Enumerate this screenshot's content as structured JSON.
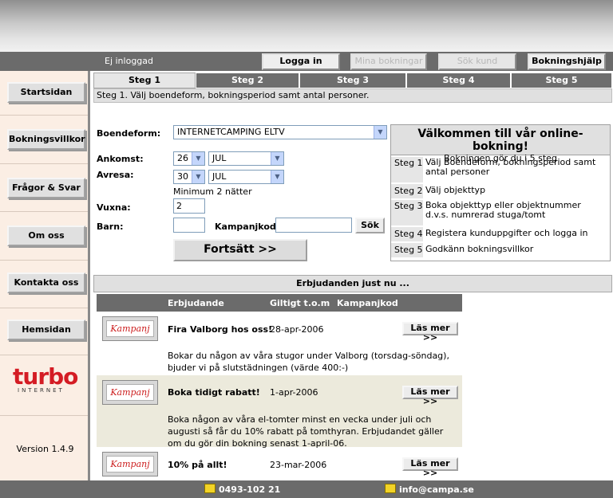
{
  "topbar": {
    "status": "Ej inloggad",
    "login": "Logga in",
    "my_bookings": "Mina bokningar",
    "search_customer": "Sök kund",
    "help": "Bokningshjälp"
  },
  "sidebar": {
    "items": [
      {
        "label": "Startsidan"
      },
      {
        "label": "Bokningsvillkor"
      },
      {
        "label": "Frågor & Svar"
      },
      {
        "label": "Om oss"
      },
      {
        "label": "Kontakta oss"
      },
      {
        "label": "Hemsidan"
      }
    ],
    "logo_main": "turbo",
    "logo_sub": "INTERNET",
    "version": "Version 1.4.9"
  },
  "steps": {
    "tabs": [
      "Steg 1",
      "Steg 2",
      "Steg 3",
      "Steg 4",
      "Steg 5"
    ],
    "active_index": 0,
    "info": "Steg 1. Välj boendeform, bokningsperiod samt antal personer."
  },
  "form": {
    "boendeform_label": "Boendeform:",
    "boendeform_value": "INTERNETCAMPING ELTV",
    "ankomst_label": "Ankomst:",
    "ankomst_day": "26",
    "ankomst_month": "JUL",
    "avresa_label": "Avresa:",
    "avresa_day": "30",
    "avresa_month": "JUL",
    "min_note": "Minimum 2 nätter",
    "vuxna_label": "Vuxna:",
    "vuxna_value": "2",
    "barn_label": "Barn:",
    "barn_value": "",
    "kampanjkod_label": "Kampanjkod:",
    "kampanjkod_value": "",
    "search_button": "Sök",
    "continue_button": "Fortsätt >>"
  },
  "welcome": {
    "title": "Välkommen till vår online-bokning!",
    "subtitle": "Bokningen gör du i 5 steg",
    "steps": [
      {
        "num": "Steg 1",
        "text": "Välj Boendeform, bokningsperiod samt antal personer"
      },
      {
        "num": "Steg 2",
        "text": "Välj objekttyp"
      },
      {
        "num": "Steg 3",
        "text": "Boka objekttyp eller objektnummer d.v.s. numrerad stuga/tomt"
      },
      {
        "num": "Steg 4",
        "text": "Registera kunduppgifter och logga in"
      },
      {
        "num": "Steg 5",
        "text": "Godkänn bokningsvillkor"
      }
    ]
  },
  "offers": {
    "heading": "Erbjudanden just nu ...",
    "columns": [
      "Erbjudande",
      "Giltigt t.o.m",
      "Kampanjkod"
    ],
    "badge": "Kampanj",
    "read_more": "Läs mer >>",
    "items": [
      {
        "title": "Fira Valborg hos oss!",
        "date": "28-apr-2006",
        "desc": "Bokar du någon av våra stugor under Valborg (torsdag-söndag), bjuder vi på slutstädningen (värde 400:-)"
      },
      {
        "title": "Boka tidigt rabatt!",
        "date": "1-apr-2006",
        "desc": "Boka någon av våra el-tomter minst en vecka under juli och augusti så får du 10% rabatt på tomthyran. Erbjudandet gäller om du gör din bokning senast 1-april-06."
      },
      {
        "title": "10% på allt!",
        "date": "23-mar-2006",
        "desc": ""
      }
    ]
  },
  "footer": {
    "phone": "0493-102 21",
    "email": "info@campa.se"
  },
  "colors": {
    "bar": "#6b6b6b",
    "sidebar_bg": "#fbeee4",
    "brand_red": "#d41c24",
    "offer_shade": "#eceadc"
  }
}
